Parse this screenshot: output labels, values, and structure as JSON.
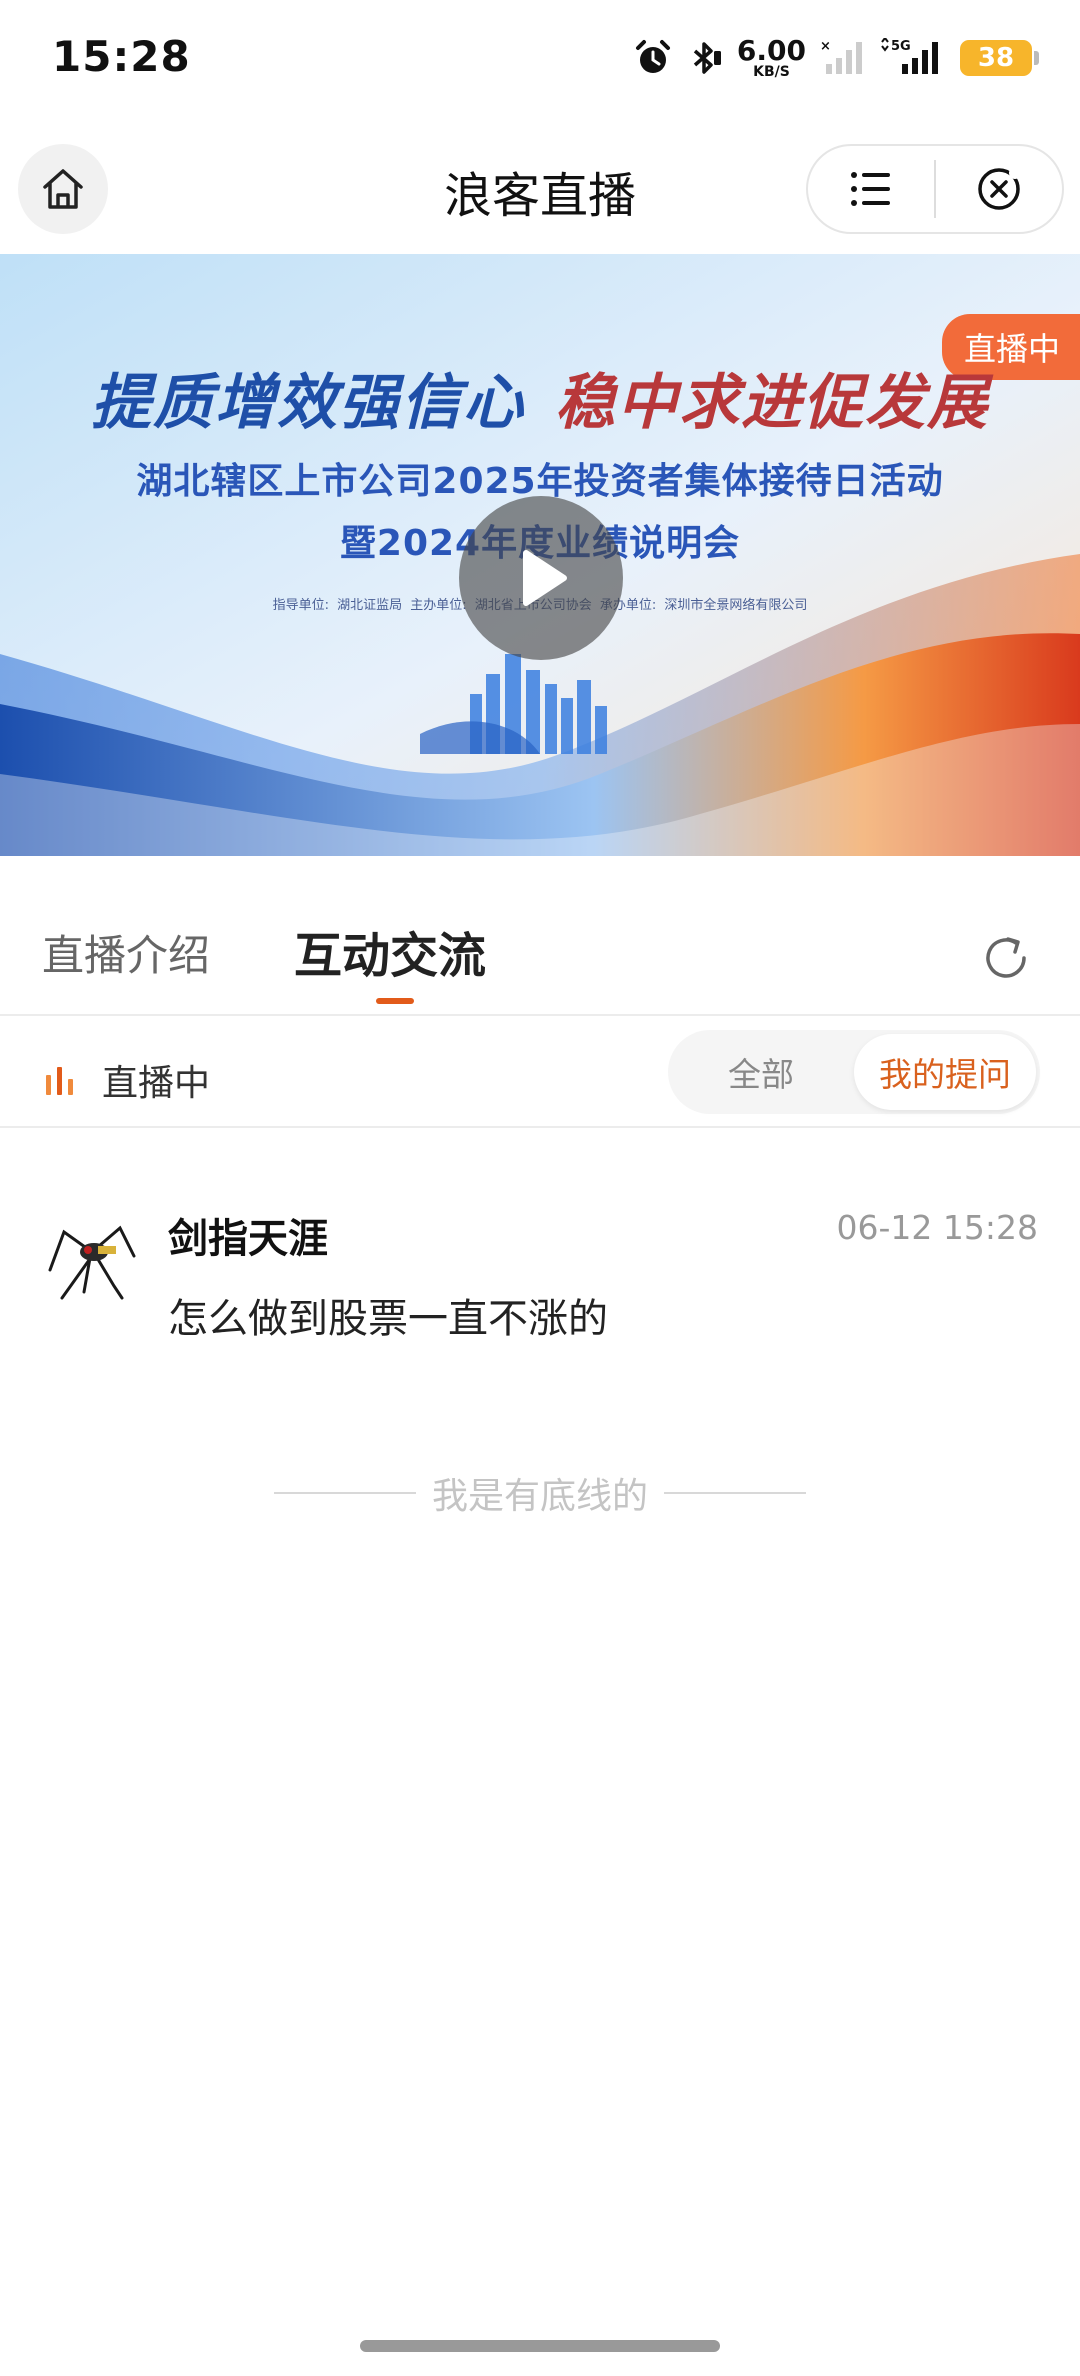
{
  "status_bar": {
    "time": "15:28",
    "net_speed_value": "6.00",
    "net_speed_unit": "KB/S",
    "network": "5G",
    "battery": "38",
    "icons": [
      "alarm-icon",
      "bluetooth-icon",
      "signal-weak-icon",
      "signal-5g-icon",
      "battery-icon"
    ]
  },
  "header": {
    "title": "浪客直播",
    "home_icon": "home-icon",
    "menu_icon": "list-icon",
    "close_icon": "close-circle-icon"
  },
  "banner": {
    "live_badge": "直播中",
    "slogan_part1": "提质增效强信心",
    "slogan_part2": "稳中求进促发展",
    "line1": "湖北辖区上市公司2025年投资者集体接待日活动",
    "line2": "暨2024年度业绩说明会",
    "credits": "指导单位: 湖北证监局    主办单位: 湖北省上市公司协会    承办单位: 深圳市全景网络有限公司",
    "play_icon": "play-icon"
  },
  "tabs": {
    "items": [
      {
        "label": "直播介绍",
        "active": false
      },
      {
        "label": "互动交流",
        "active": true
      }
    ],
    "refresh_icon": "refresh-icon",
    "accent_color": "#e25b1a"
  },
  "filter": {
    "live_status": "直播中",
    "options": [
      "全部",
      "我的提问"
    ],
    "selected": "我的提问"
  },
  "messages": [
    {
      "user": "剑指天涯",
      "time": "06-12 15:28",
      "text": "怎么做到股票一直不涨的"
    }
  ],
  "footer": {
    "end_text": "我是有底线的"
  }
}
